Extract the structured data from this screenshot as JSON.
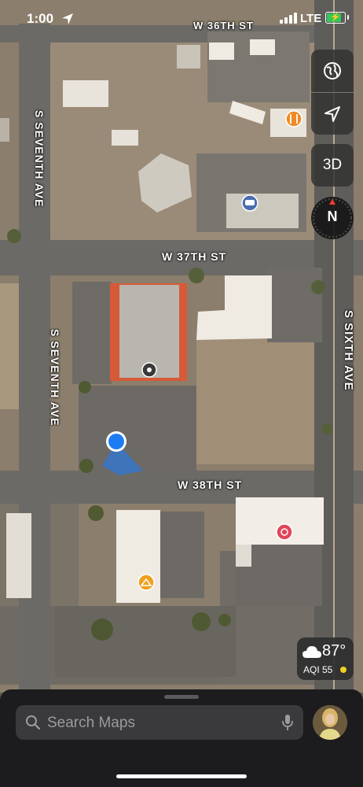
{
  "status_bar": {
    "time": "1:00",
    "network": "LTE"
  },
  "map": {
    "streets": [
      {
        "id": "w36",
        "label": "W 36TH ST"
      },
      {
        "id": "w37",
        "label": "W 37TH ST"
      },
      {
        "id": "w38",
        "label": "W 38TH ST"
      },
      {
        "id": "seventh_upper",
        "label": "S SEVENTH AVE"
      },
      {
        "id": "seventh_lower",
        "label": "S SEVENTH AVE"
      },
      {
        "id": "sixth",
        "label": "S SIXTH AVE"
      }
    ],
    "pois": [
      {
        "name": "restaurant-poi-icon",
        "color": "#f08a24"
      },
      {
        "name": "car-poi-icon",
        "color": "#4a6fb0"
      },
      {
        "name": "store-poi-icon",
        "color": "#3a3a3a"
      },
      {
        "name": "clothing-poi-icon",
        "color": "#f0a020"
      },
      {
        "name": "brand-poi-icon",
        "color": "#e0455a"
      }
    ]
  },
  "controls": {
    "map_mode_icon": "globe-icon",
    "location_icon": "location-arrow-icon",
    "three_d_label": "3D",
    "compass_label": "N"
  },
  "weather": {
    "temperature": "87°",
    "aqi_text": "AQI 55",
    "aqi_color": "#f2d024"
  },
  "search": {
    "placeholder": "Search Maps"
  },
  "colors": {
    "sheet_bg": "#1c1c1e",
    "search_bg": "#3a3a3c",
    "location_dot": "#1e7cf2"
  }
}
